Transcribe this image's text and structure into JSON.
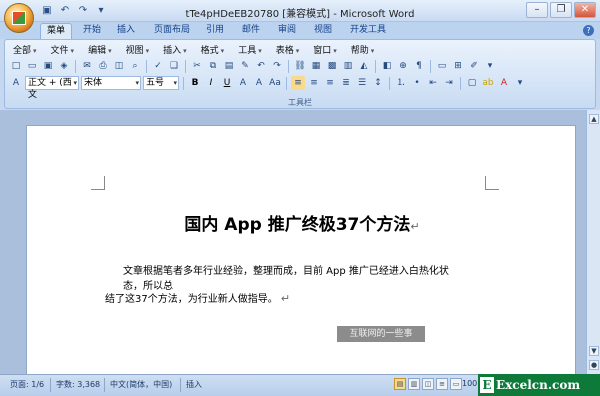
{
  "window": {
    "title": "tTe4pHDeEB20780 [兼容模式] - Microsoft Word",
    "controls": {
      "minimize": "–",
      "restore": "❐",
      "close": "✕"
    }
  },
  "quick_access": [
    "save-icon",
    "undo-icon",
    "redo-icon",
    "customize-icon"
  ],
  "tabs": [
    {
      "label": "菜单",
      "active": true
    },
    {
      "label": "开始"
    },
    {
      "label": "插入"
    },
    {
      "label": "页面布局"
    },
    {
      "label": "引用"
    },
    {
      "label": "邮件"
    },
    {
      "label": "审阅"
    },
    {
      "label": "视图"
    },
    {
      "label": "开发工具"
    }
  ],
  "menus": [
    "全部",
    "文件",
    "编辑",
    "视图",
    "插入",
    "格式",
    "工具",
    "表格",
    "窗口",
    "帮助"
  ],
  "formatting": {
    "style_value": "正文 + (西文",
    "font_value": "宋体",
    "size_value": "五号",
    "bold": "B",
    "italic": "I",
    "underline": "U"
  },
  "ribbon_group_label": "工具栏",
  "document": {
    "title": "国内 App 推广终极37个方法",
    "paragraph_line1": "文章根据笔者多年行业经验，整理而成，目前 App 推广已经进入白热化状态，所以总",
    "paragraph_line2": "结了这37个方法，为行业新人做指导。",
    "para_mark": "↵",
    "watermark": "互联网的一些事"
  },
  "status": {
    "page": "页面: 1/6",
    "words": "字数: 3,368",
    "language": "中文(简体，中国)",
    "mode": "插入",
    "zoom": "100"
  },
  "brand": {
    "text": "Excelcn.com",
    "letter": "E"
  }
}
